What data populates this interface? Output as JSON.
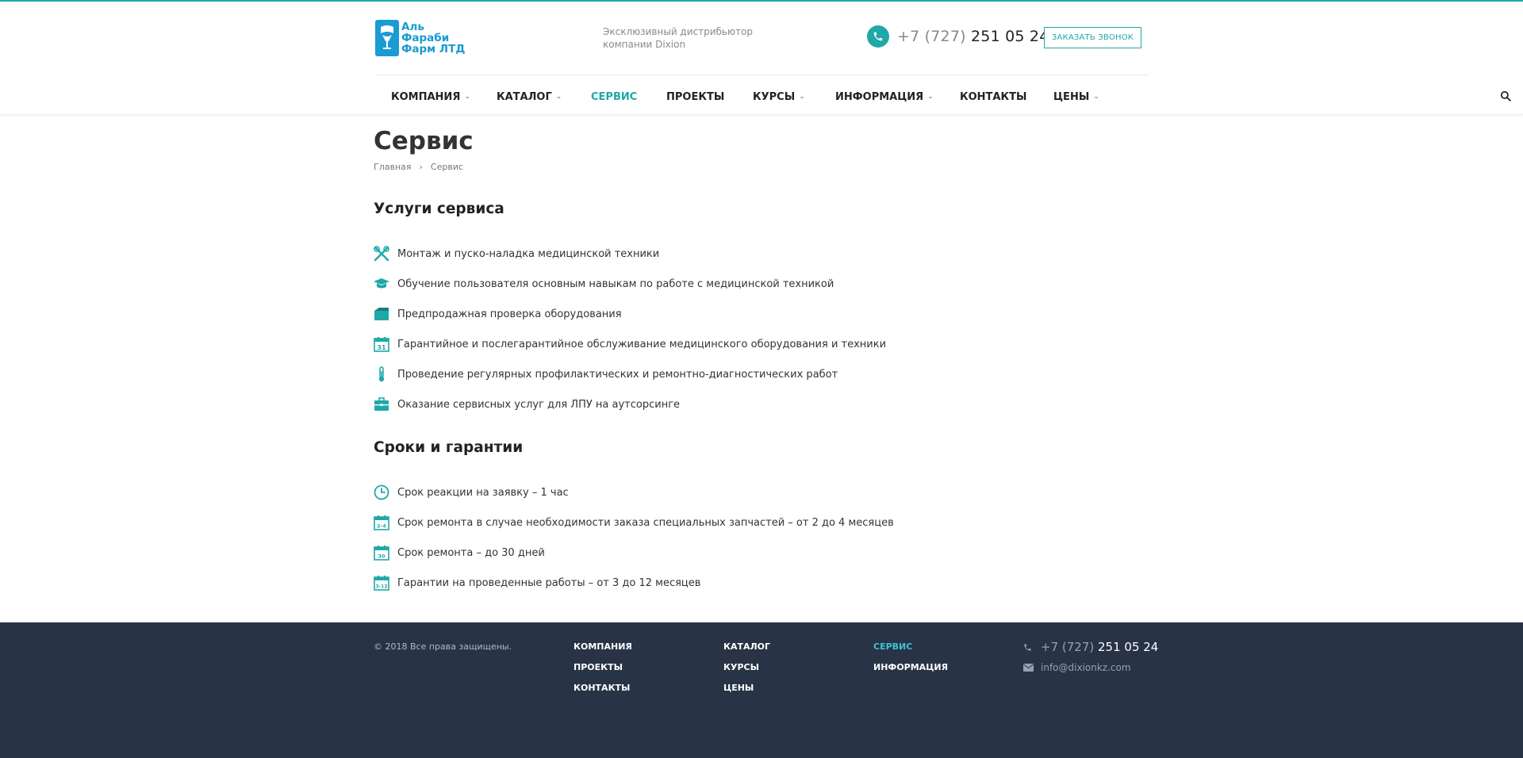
{
  "header": {
    "logo_lines": [
      "Аль",
      "Фараби",
      "Фарм ЛТД"
    ],
    "distributor_line1": "Эксклюзивный дистрибьютор",
    "distributor_line2": "компании Dixion",
    "phone_code": "+7 (727)",
    "phone_number": "251 05 24",
    "callback_label": "ЗАКАЗАТЬ ЗВОНОК"
  },
  "nav": {
    "items": [
      {
        "label": "КОМПАНИЯ",
        "dropdown": true
      },
      {
        "label": "КАТАЛОГ",
        "dropdown": true
      },
      {
        "label": "СЕРВИС",
        "dropdown": false,
        "active": true
      },
      {
        "label": "ПРОЕКТЫ",
        "dropdown": false
      },
      {
        "label": "КУРСЫ",
        "dropdown": true
      },
      {
        "label": "ИНФОРМАЦИЯ",
        "dropdown": true
      },
      {
        "label": "КОНТАКТЫ",
        "dropdown": false
      },
      {
        "label": "ЦЕНЫ",
        "dropdown": true
      }
    ]
  },
  "page": {
    "title": "Сервис",
    "breadcrumb": [
      "Главная",
      "Сервис"
    ]
  },
  "services": {
    "title": "Услуги сервиса",
    "items": [
      {
        "icon": "tools-icon",
        "text": "Монтаж и пуско-наладка медицинской техники"
      },
      {
        "icon": "graduation-cap-icon",
        "text": "Обучение пользователя основным навыкам по работе с медицинской техникой"
      },
      {
        "icon": "box-icon",
        "text": "Предпродажная проверка оборудования"
      },
      {
        "icon": "calendar-31-icon",
        "text": "Гарантийное и послегарантийное обслуживание медицинского оборудования и техники"
      },
      {
        "icon": "thermometer-icon",
        "text": "Проведение регулярных профилактических и ремонтно-диагностических работ"
      },
      {
        "icon": "briefcase-icon",
        "text": "Оказание сервисных услуг для ЛПУ на аутсорсинге"
      }
    ]
  },
  "terms": {
    "title": "Сроки и гарантии",
    "items": [
      {
        "icon": "clock-icon",
        "badge": "",
        "text": "Срок реакции на заявку – 1 час"
      },
      {
        "icon": "calendar-2-4-icon",
        "badge": "2-4",
        "text": "Срок ремонта в случае необходимости заказа специальных запчастей – от 2 до 4 месяцев"
      },
      {
        "icon": "calendar-30-icon",
        "badge": "30",
        "text": "Срок ремонта – до 30 дней"
      },
      {
        "icon": "calendar-3-12-icon",
        "badge": "3-12",
        "text": "Гарантии на проведенные работы – от 3 до 12 месяцев"
      }
    ]
  },
  "footer": {
    "copyright": "© 2018 Все права защищены.",
    "col1": [
      "КОМПАНИЯ",
      "ПРОЕКТЫ",
      "КОНТАКТЫ"
    ],
    "col2": [
      "КАТАЛОГ",
      "КУРСЫ",
      "ЦЕНЫ"
    ],
    "col3": [
      "СЕРВИС",
      "ИНФОРМАЦИЯ"
    ],
    "phone_code": "+7 (727)",
    "phone_number": "251 05 24",
    "email": "info@dixionkz.com"
  },
  "colors": {
    "accent": "#1fa8a8",
    "footer_bg": "#283346",
    "logo_blue": "#1a9bd1"
  }
}
